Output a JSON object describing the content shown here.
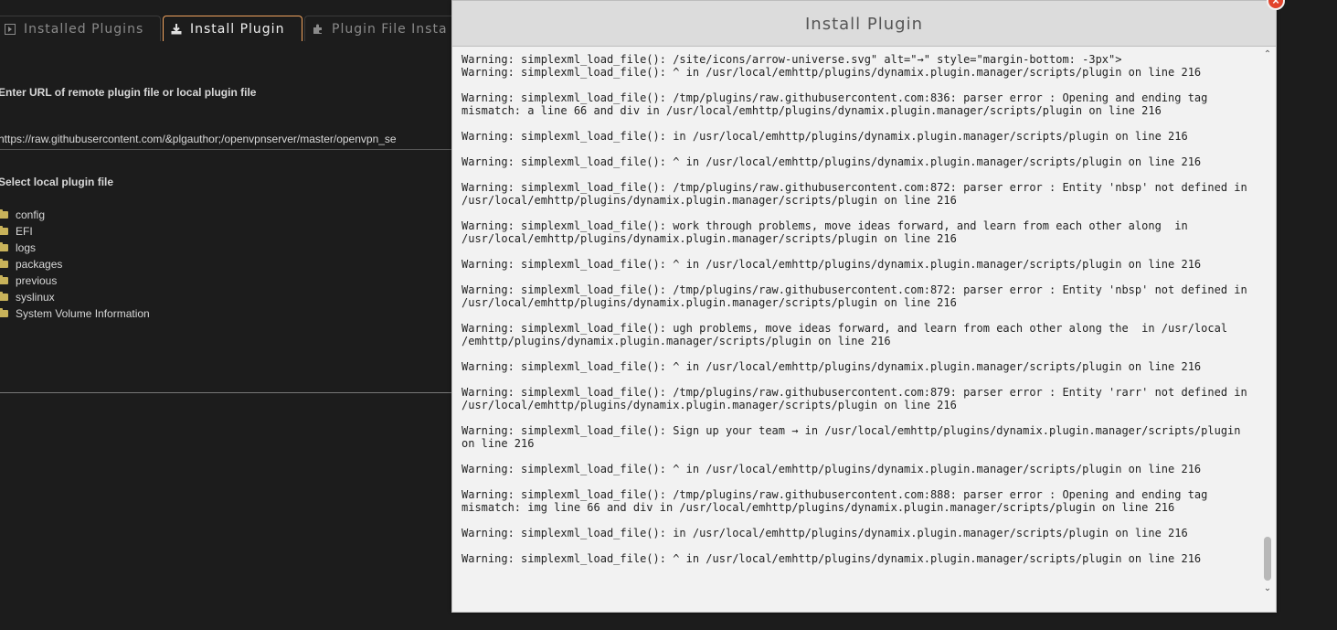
{
  "tabs": [
    {
      "label": "Installed Plugins",
      "icon": "plugin-list-icon"
    },
    {
      "label": "Install Plugin",
      "icon": "download-icon"
    },
    {
      "label": "Plugin File Insta",
      "icon": "puzzle-icon"
    }
  ],
  "url_section": {
    "label": "Enter URL of remote plugin file or local plugin file",
    "value": "https://raw.githubusercontent.com/&plgauthor;/openvpnserver/master/openvpn_se"
  },
  "local_section": {
    "label": "Select local plugin file",
    "items": [
      "config",
      "EFI",
      "logs",
      "packages",
      "previous",
      "syslinux",
      "System Volume Information"
    ]
  },
  "dialog": {
    "title": "Install Plugin",
    "close_label": "×",
    "log_lines": [
      "",
      "Warning: simplexml_load_file(): /site/icons/arrow-universe.svg\" alt=\"→\" style=\"margin-bottom: -3px\">",
      "Warning: simplexml_load_file(): ^ in /usr/local/emhttp/plugins/dynamix.plugin.manager/scripts/plugin on line 216",
      "",
      "Warning: simplexml_load_file(): /tmp/plugins/raw.githubusercontent.com:836: parser error : Opening and ending tag",
      "mismatch: a line 66 and div in /usr/local/emhttp/plugins/dynamix.plugin.manager/scripts/plugin on line 216",
      "",
      "Warning: simplexml_load_file(): in /usr/local/emhttp/plugins/dynamix.plugin.manager/scripts/plugin on line 216",
      "",
      "Warning: simplexml_load_file(): ^ in /usr/local/emhttp/plugins/dynamix.plugin.manager/scripts/plugin on line 216",
      "",
      "Warning: simplexml_load_file(): /tmp/plugins/raw.githubusercontent.com:872: parser error : Entity 'nbsp' not defined in",
      "/usr/local/emhttp/plugins/dynamix.plugin.manager/scripts/plugin on line 216",
      "",
      "Warning: simplexml_load_file(): work through problems, move ideas forward, and learn from each other along  in",
      "/usr/local/emhttp/plugins/dynamix.plugin.manager/scripts/plugin on line 216",
      "",
      "Warning: simplexml_load_file(): ^ in /usr/local/emhttp/plugins/dynamix.plugin.manager/scripts/plugin on line 216",
      "",
      "Warning: simplexml_load_file(): /tmp/plugins/raw.githubusercontent.com:872: parser error : Entity 'nbsp' not defined in",
      "/usr/local/emhttp/plugins/dynamix.plugin.manager/scripts/plugin on line 216",
      "",
      "Warning: simplexml_load_file(): ugh problems, move ideas forward, and learn from each other along the  in /usr/local",
      "/emhttp/plugins/dynamix.plugin.manager/scripts/plugin on line 216",
      "",
      "Warning: simplexml_load_file(): ^ in /usr/local/emhttp/plugins/dynamix.plugin.manager/scripts/plugin on line 216",
      "",
      "Warning: simplexml_load_file(): /tmp/plugins/raw.githubusercontent.com:879: parser error : Entity 'rarr' not defined in",
      "/usr/local/emhttp/plugins/dynamix.plugin.manager/scripts/plugin on line 216",
      "",
      "Warning: simplexml_load_file(): Sign up your team → in /usr/local/emhttp/plugins/dynamix.plugin.manager/scripts/plugin",
      "on line 216",
      "",
      "Warning: simplexml_load_file(): ^ in /usr/local/emhttp/plugins/dynamix.plugin.manager/scripts/plugin on line 216",
      "",
      "Warning: simplexml_load_file(): /tmp/plugins/raw.githubusercontent.com:888: parser error : Opening and ending tag",
      "mismatch: img line 66 and div in /usr/local/emhttp/plugins/dynamix.plugin.manager/scripts/plugin on line 216",
      "",
      "Warning: simplexml_load_file(): in /usr/local/emhttp/plugins/dynamix.plugin.manager/scripts/plugin on line 216",
      "",
      "Warning: simplexml_load_file(): ^ in /usr/local/emhttp/plugins/dynamix.plugin.manager/scripts/plugin on line 216"
    ],
    "scroll_position": 0.95
  },
  "colors": {
    "active_tab_border": "#f0a35e",
    "close_button": "#e2442c",
    "folder": "#c8b25a"
  }
}
